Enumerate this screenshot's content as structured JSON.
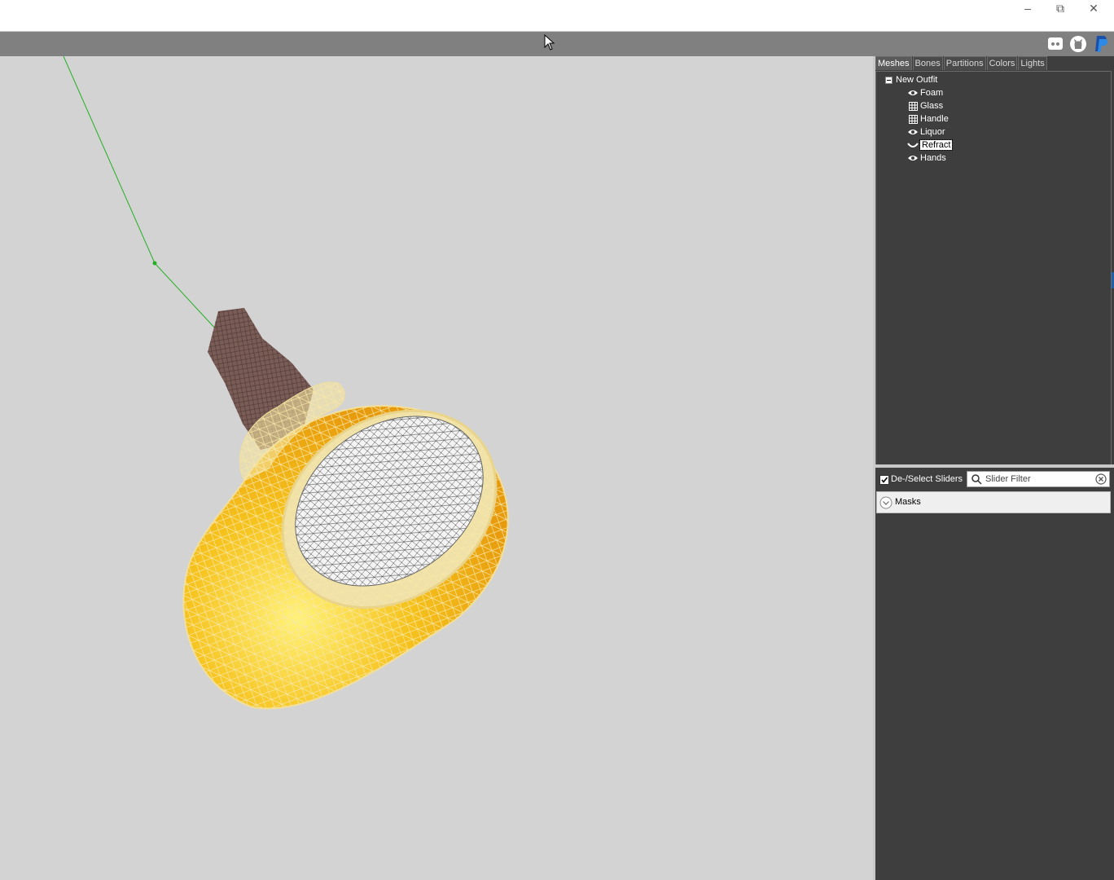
{
  "window": {
    "minimize_glyph": "–",
    "restore_glyph": "⧉",
    "close_glyph": "✕"
  },
  "toolbar": {
    "icons": [
      "discord-icon",
      "github-icon",
      "paypal-icon"
    ]
  },
  "tabs": [
    "Meshes",
    "Bones",
    "Partitions",
    "Colors",
    "Lights"
  ],
  "active_tab": "Meshes",
  "tree": {
    "root": "New Outfit",
    "items": [
      {
        "label": "Foam",
        "icon": "eye-icon"
      },
      {
        "label": "Glass",
        "icon": "wireframe-icon"
      },
      {
        "label": "Handle",
        "icon": "wireframe-icon"
      },
      {
        "label": "Liquor",
        "icon": "eye-icon"
      },
      {
        "label": "Refract",
        "icon": "hidden-icon",
        "selected": true
      },
      {
        "label": "Hands",
        "icon": "eye-icon"
      }
    ]
  },
  "sliders": {
    "deselect_label": "De-/Select Sliders",
    "filter_placeholder": "Slider Filter",
    "checked": true
  },
  "masks": {
    "label": "Masks"
  },
  "colors": {
    "panel_bg": "#3e3e3e",
    "toolbar_bg": "#808080",
    "viewport_bg": "#d3d3d3",
    "bone_line": "#22b022",
    "mug_fill": "#f2b418",
    "wire": "#f6e6a6",
    "hand": "#7a5c56"
  }
}
